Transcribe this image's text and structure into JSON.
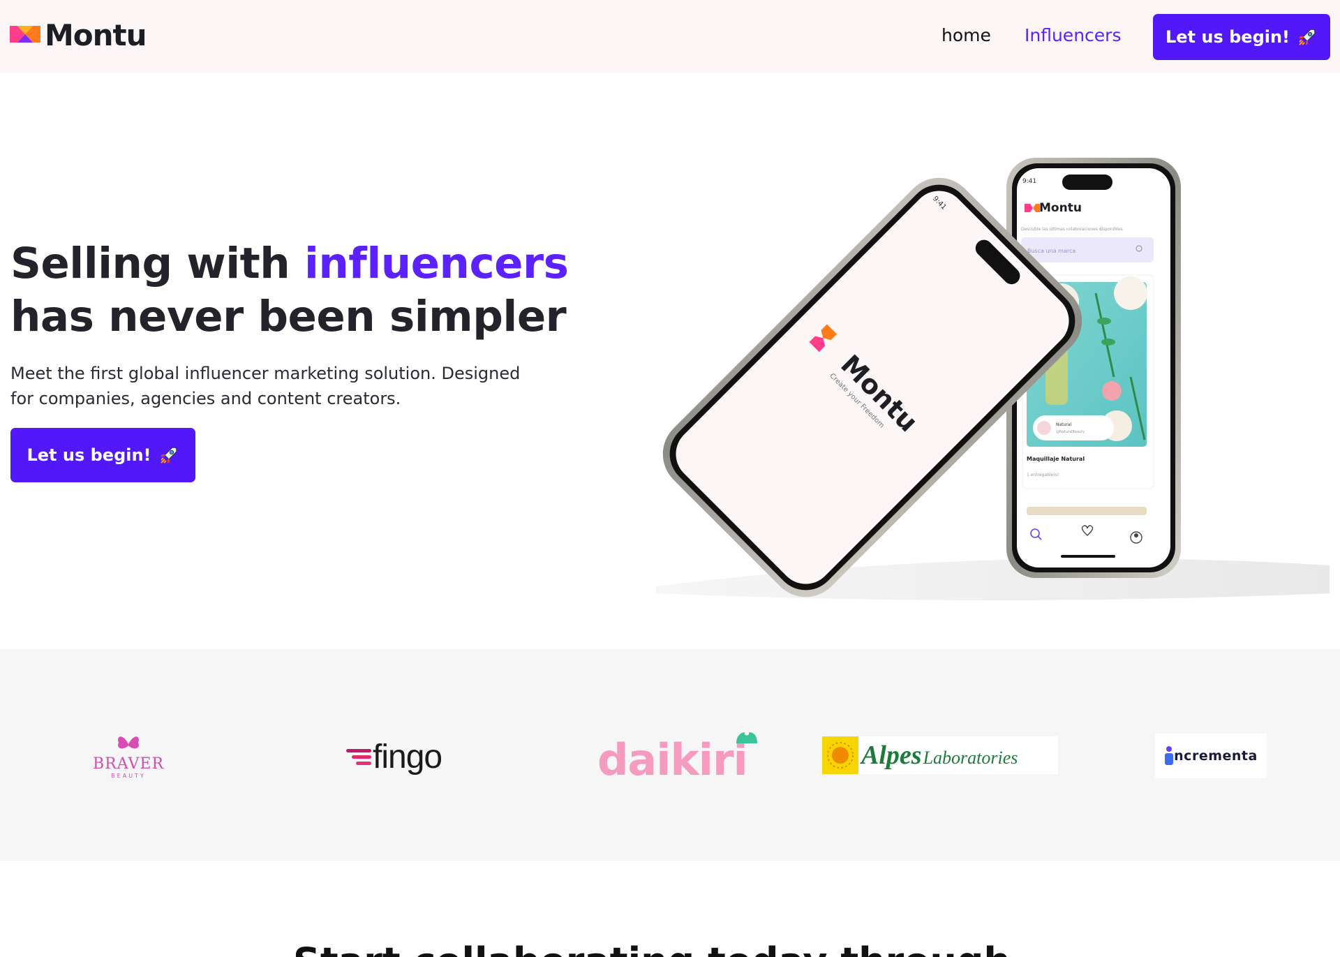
{
  "nav": {
    "brand": "Montu",
    "links": [
      {
        "label": "home"
      },
      {
        "label": "Influencers"
      }
    ],
    "cta_label": "Let us begin!",
    "cta_icon": "rocket-icon"
  },
  "hero": {
    "title_part1": "Selling with ",
    "title_accent": "influencers",
    "title_part2": "has never been simpler",
    "subtitle": "Meet the first global influencer marketing solution. Designed for companies, agencies and content creators.",
    "cta_label": "Let us begin!",
    "cta_icon": "rocket-icon"
  },
  "phone_left": {
    "time": "9:41",
    "brand": "Montu",
    "tagline": "Create your Freedom"
  },
  "phone_right": {
    "time": "9:41",
    "brand": "Montu",
    "subtitle": "Descubre las últimas colaboraciones disponibles",
    "search_placeholder": "Busca una marca",
    "card_brand": "Natural",
    "card_handle": "@NaturalBeauty",
    "card_title": "Maquillaje Natural",
    "card_meta": "1 entregable(s)"
  },
  "brands": [
    {
      "name": "BRAVER",
      "sub": "BEAUTY"
    },
    {
      "name": "fingo"
    },
    {
      "name": "daikiri"
    },
    {
      "name": "Alpes",
      "sub": "Laboratories"
    },
    {
      "name": "ncrementa"
    }
  ],
  "colors": {
    "accent": "#5b21ff",
    "button": "#5218fa",
    "nav_bg": "#fcf6f7",
    "brands_bg": "#f6f6f6"
  },
  "section2": {
    "heading": "Start collaborating today through"
  }
}
